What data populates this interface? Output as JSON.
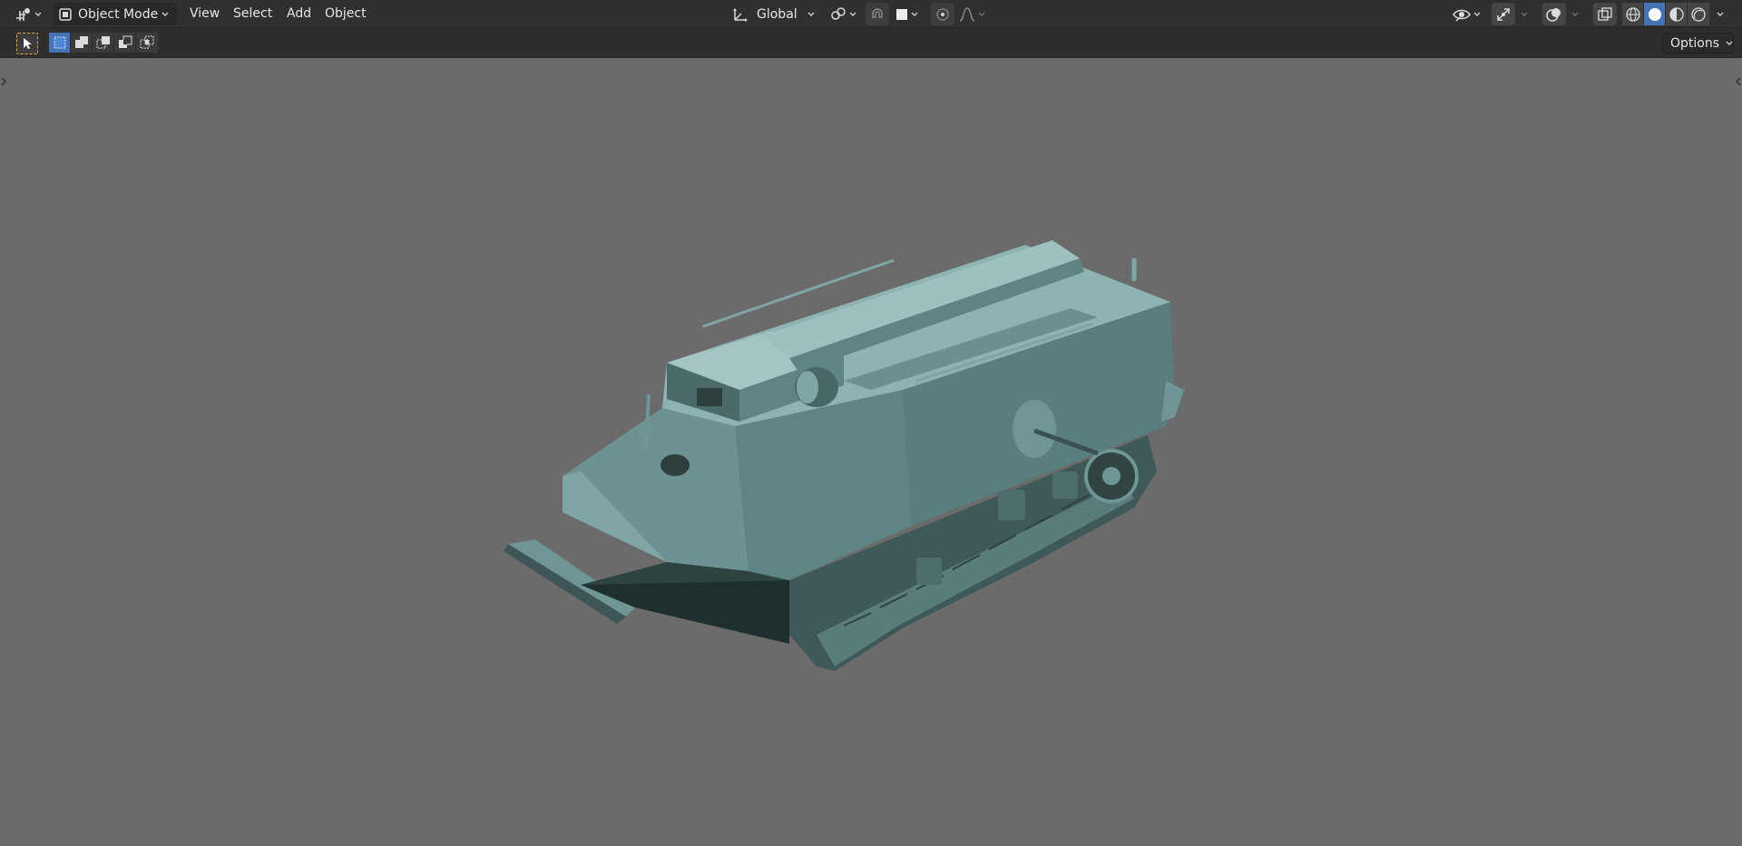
{
  "header": {
    "mode_label": "Object Mode",
    "menus": [
      "View",
      "Select",
      "Add",
      "Object"
    ],
    "orientation_label": "Global"
  },
  "toolbar": {
    "options_label": "Options"
  },
  "colors": {
    "header_bg": "#303030",
    "viewport_bg": "#6b6b6b",
    "accent": "#4772b3",
    "select_tool_border": "#e8a24a",
    "model_color": "#5e8584"
  },
  "icons": {
    "editor_type": "editor-type-icon",
    "mode": "object-mode-icon",
    "orientation": "transform-orientation-icon",
    "pivot": "pivot-point-icon",
    "snap": "snap-magnet-icon",
    "proportional": "proportional-edit-icon",
    "falloff": "falloff-curve-icon",
    "visibility": "visibility-eye-icon",
    "gizmo": "gizmo-icon",
    "overlays": "overlays-icon",
    "xray": "xray-icon",
    "shading_wire": "wireframe-shading-icon",
    "shading_solid": "solid-shading-icon",
    "shading_material": "material-shading-icon",
    "shading_rendered": "rendered-shading-icon",
    "select_tool": "select-box-tool-icon"
  }
}
